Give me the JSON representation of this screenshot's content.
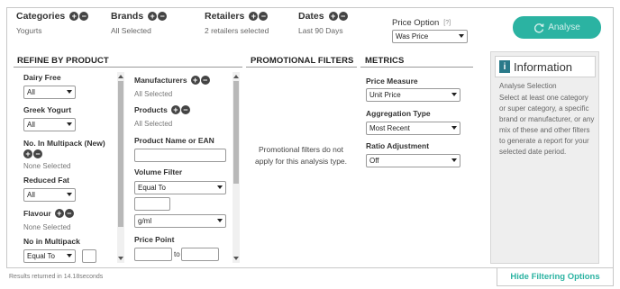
{
  "header": {
    "categories": {
      "title": "Categories",
      "value": "Yogurts"
    },
    "brands": {
      "title": "Brands",
      "value": "All Selected"
    },
    "retailers": {
      "title": "Retailers",
      "value": "2 retailers selected"
    },
    "dates": {
      "title": "Dates",
      "value": "Last 90 Days"
    },
    "price_option": {
      "title": "Price Option",
      "help": "[?]",
      "selected": "Was Price"
    },
    "analyse_label": "Analyse"
  },
  "refine": {
    "title": "REFINE BY PRODUCT",
    "col1": {
      "dairy_free": {
        "label": "Dairy Free",
        "selected": "All"
      },
      "greek_yogurt": {
        "label": "Greek Yogurt",
        "selected": "All"
      },
      "multipack_new": {
        "label": "No. In Multipack (New)",
        "value": "None Selected"
      },
      "reduced_fat": {
        "label": "Reduced Fat",
        "selected": "All"
      },
      "flavour": {
        "label": "Flavour",
        "value": "None Selected"
      },
      "no_in_multipack": {
        "label": "No in Multipack",
        "selected": "Equal To"
      }
    },
    "col2": {
      "manufacturers": {
        "label": "Manufacturers",
        "value": "All Selected"
      },
      "products": {
        "label": "Products",
        "value": "All Selected"
      },
      "product_name": {
        "label": "Product Name or EAN"
      },
      "volume_filter": {
        "label": "Volume Filter",
        "selected": "Equal To",
        "unit_selected": "g/ml"
      },
      "price_point": {
        "label": "Price Point",
        "to_label": "to"
      }
    }
  },
  "promotional": {
    "title": "PROMOTIONAL FILTERS",
    "message": "Promotional filters do not apply for this analysis type."
  },
  "metrics": {
    "title": "METRICS",
    "price_measure": {
      "label": "Price Measure",
      "selected": "Unit Price"
    },
    "aggregation_type": {
      "label": "Aggregation Type",
      "selected": "Most Recent"
    },
    "ratio_adjustment": {
      "label": "Ratio Adjustment",
      "selected": "Off"
    }
  },
  "information": {
    "title": "Information",
    "subtitle": "Analyse Selection",
    "text": "Select at least one category or super category, a specific brand or manufacturer, or any mix of these and other filters to generate a report for your selected date period."
  },
  "footer": {
    "results": "Results returned in 14.18seconds",
    "hide_filters": "Hide Filtering Options"
  },
  "colors": {
    "accent": "#2bb3a2",
    "info_icon": "#2a7a8a"
  }
}
